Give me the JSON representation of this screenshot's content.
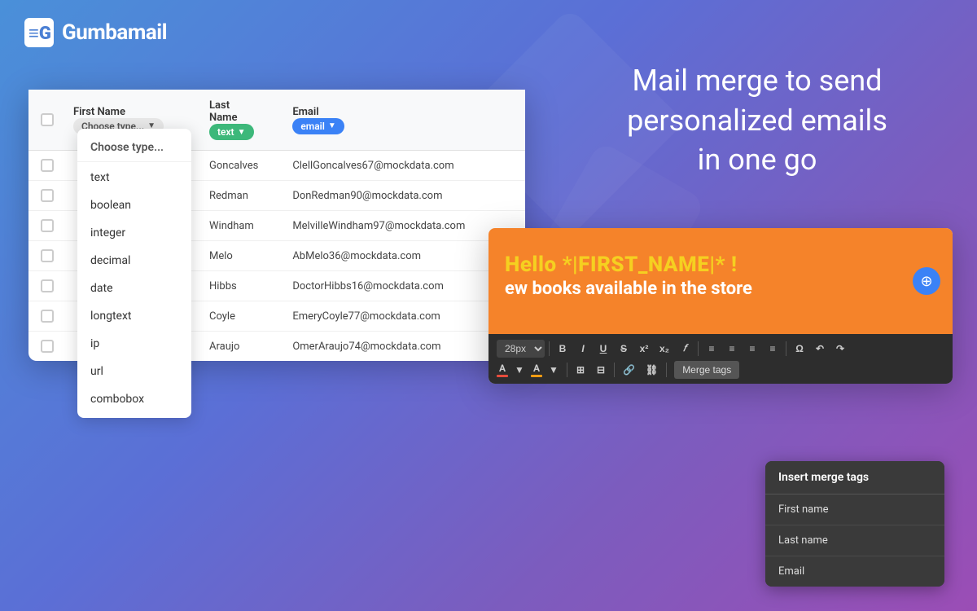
{
  "logo": {
    "text": "Gumbamail"
  },
  "headline": {
    "line1": "Mail merge to send",
    "line2": "personalized emails",
    "line3": "in one go"
  },
  "spreadsheet": {
    "columns": [
      {
        "label": ""
      },
      {
        "label": "First Name"
      },
      {
        "label": "Last\nName"
      },
      {
        "label": "Email"
      }
    ],
    "first_name_badge": "Choose type...",
    "last_name_badge": "text",
    "email_badge": "email",
    "rows": [
      {
        "id": 1,
        "last_name": "Goncalves",
        "email": "ClellGoncalves67@mockdata.com"
      },
      {
        "id": 2,
        "last_name": "Redman",
        "email": "DonRedman90@mockdata.com"
      },
      {
        "id": 3,
        "last_name": "Windham",
        "email": "MelvilleWindham97@mockdata.com"
      },
      {
        "id": 4,
        "last_name": "Melo",
        "email": "AbMelo36@mockdata.com"
      },
      {
        "id": 5,
        "last_name": "Hibbs",
        "email": "DoctorHibbs16@mockdata.com"
      },
      {
        "id": 6,
        "last_name": "Coyle",
        "email": "EmeryCoyle77@mockdata.com"
      },
      {
        "id": 7,
        "last_name": "Araujo",
        "email": "OmerAraujo74@mockdata.com"
      }
    ]
  },
  "dropdown": {
    "items": [
      "Choose type...",
      "text",
      "boolean",
      "integer",
      "decimal",
      "date",
      "longtext",
      "ip",
      "url",
      "combobox"
    ]
  },
  "editor": {
    "merge_text": "Hello *|FIRST_NAME|* !",
    "sub_text": "ew books available in the store",
    "font_size": "28px",
    "toolbar_buttons": [
      "B",
      "I",
      "U",
      "S",
      "x²",
      "x₂",
      "𝑓",
      "≡",
      "≡",
      "≡",
      "≡",
      "Ω",
      "↶",
      "↷"
    ],
    "merge_tags_label": "Merge tags"
  },
  "merge_tags_panel": {
    "title": "Insert merge tags",
    "items": [
      "First name",
      "Last name",
      "Email"
    ]
  }
}
